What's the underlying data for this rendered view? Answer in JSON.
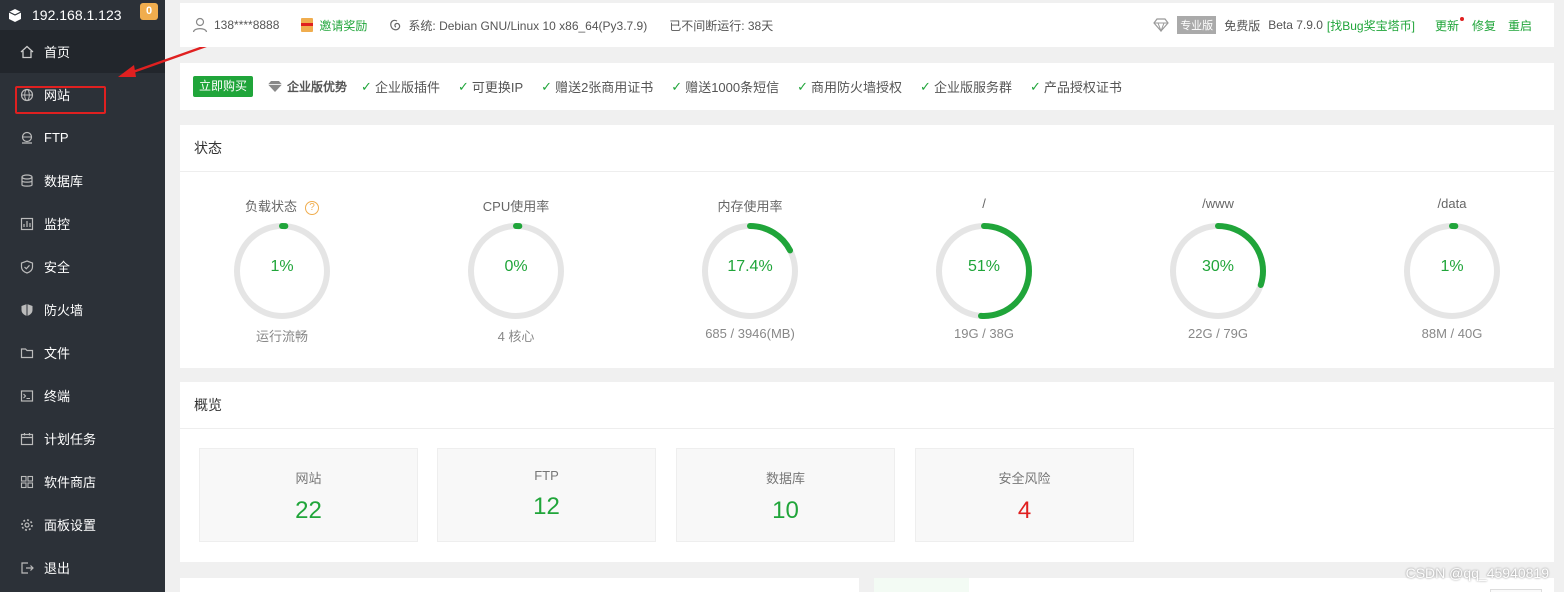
{
  "sidebar": {
    "server_ip": "192.168.1.123",
    "badge": "0",
    "items": [
      {
        "label": "首页",
        "icon": "home-icon"
      },
      {
        "label": "网站",
        "icon": "globe-icon"
      },
      {
        "label": "FTP",
        "icon": "ftp-icon"
      },
      {
        "label": "数据库",
        "icon": "database-icon"
      },
      {
        "label": "监控",
        "icon": "monitor-icon"
      },
      {
        "label": "安全",
        "icon": "shield-check-icon"
      },
      {
        "label": "防火墙",
        "icon": "firewall-icon"
      },
      {
        "label": "文件",
        "icon": "folder-icon"
      },
      {
        "label": "终端",
        "icon": "terminal-icon"
      },
      {
        "label": "计划任务",
        "icon": "calendar-icon"
      },
      {
        "label": "软件商店",
        "icon": "apps-icon"
      },
      {
        "label": "面板设置",
        "icon": "gear-icon"
      },
      {
        "label": "退出",
        "icon": "logout-icon"
      }
    ]
  },
  "topbar": {
    "user": "138****8888",
    "invite": "邀请奖励",
    "system": "系统:   Debian GNU/Linux 10 x86_64(Py3.7.9)",
    "uptime": "已不间断运行: 38天",
    "pro_tag": "专业版",
    "edition": "免费版",
    "version": "Beta 7.9.0",
    "bug_link": "[找Bug奖宝塔币]",
    "update": "更新",
    "repair": "修复",
    "restart": "重启"
  },
  "buybar": {
    "buy_button": "立即购买",
    "enterprise_title": "企业版优势",
    "features": [
      "企业版插件",
      "可更换IP",
      "赠送2张商用证书",
      "赠送1000条短信",
      "商用防火墙授权",
      "企业版服务群",
      "产品授权证书"
    ]
  },
  "status": {
    "title": "状态",
    "gauges": [
      {
        "title": "负载状态",
        "has_help": true,
        "value": "1%",
        "percent": 1,
        "sub": "运行流畅"
      },
      {
        "title": "CPU使用率",
        "has_help": false,
        "value": "0%",
        "percent": 0,
        "sub": "4 核心"
      },
      {
        "title": "内存使用率",
        "has_help": false,
        "value": "17.4%",
        "percent": 17.4,
        "sub": "685 / 3946(MB)"
      },
      {
        "title": "/",
        "has_help": false,
        "value": "51%",
        "percent": 51,
        "sub": "19G / 38G"
      },
      {
        "title": "/www",
        "has_help": false,
        "value": "30%",
        "percent": 30,
        "sub": "22G / 79G"
      },
      {
        "title": "/data",
        "has_help": false,
        "value": "1%",
        "percent": 1,
        "sub": "88M / 40G"
      }
    ]
  },
  "overview": {
    "title": "概览",
    "cards": [
      {
        "label": "网站",
        "value": "22",
        "danger": false
      },
      {
        "label": "FTP",
        "value": "12",
        "danger": false
      },
      {
        "label": "数据库",
        "value": "10",
        "danger": false
      },
      {
        "label": "安全风险",
        "value": "4",
        "danger": true
      }
    ]
  },
  "colors": {
    "accent": "#20a53a",
    "danger": "#e02020",
    "sidebar": "#2c3138",
    "track": "#e5e5e5"
  },
  "watermark": "CSDN @qq_45940819"
}
